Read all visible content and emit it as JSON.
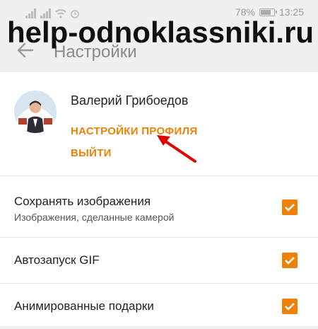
{
  "status_bar": {
    "battery": "78%",
    "time": "13:25"
  },
  "watermark": "help-odnoklassniki.ru",
  "toolbar": {
    "title": "Настройки"
  },
  "profile": {
    "name": "Валерий Грибоедов",
    "settings_link": "НАСТРОЙКИ ПРОФИЛЯ",
    "logout_link": "ВЫЙТИ"
  },
  "settings": [
    {
      "title": "Сохранять изображения",
      "subtitle": "Изображения, сделанные камерой",
      "checked": true
    },
    {
      "title": "Автозапуск GIF",
      "checked": true
    },
    {
      "title": "Анимированные подарки",
      "checked": true
    }
  ],
  "colors": {
    "accent": "#ee8208",
    "annotation": "#e00000"
  }
}
